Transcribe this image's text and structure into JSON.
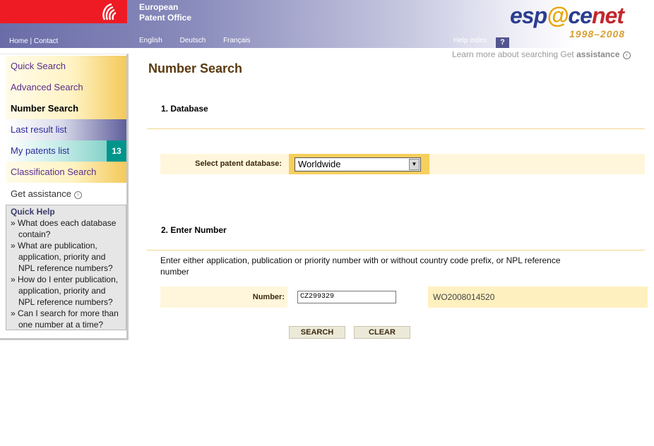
{
  "header": {
    "org_line1": "European",
    "org_line2": "Patent Office",
    "home": "Home",
    "contact": "Contact",
    "separator": "|",
    "languages": [
      "English",
      "Deutsch",
      "Français"
    ],
    "help_index": "Help index",
    "help_icon": "?",
    "logo_text_1": "esp",
    "logo_text_at": "@",
    "logo_text_2": "ce",
    "logo_text_3": "net",
    "logo_years": "1998–2008"
  },
  "learn_more": {
    "text": "Learn more about searching Get ",
    "bold": "assistance"
  },
  "sidebar": {
    "items": [
      {
        "label": "Quick Search"
      },
      {
        "label": "Advanced Search"
      },
      {
        "label": "Number Search"
      },
      {
        "label": "Last result list"
      },
      {
        "label": "My patents list",
        "badge": "13"
      },
      {
        "label": "Classification Search"
      },
      {
        "label": "Get assistance"
      }
    ],
    "quick_help": {
      "title": "Quick Help",
      "items": [
        "» What does each database contain?",
        "» What are publication, application, priority and NPL reference numbers?",
        "» How do I enter publication, application, priority and NPL reference numbers?",
        "» Can I search for more than one number at a time?"
      ]
    }
  },
  "main": {
    "title": "Number Search",
    "section1": "1. Database",
    "db_label": "Select patent database:",
    "db_value": "Worldwide",
    "section2": "2. Enter Number",
    "instructions": "Enter either application, publication or priority number with or without country code prefix, or NPL reference number",
    "number_label": "Number:",
    "number_value": "CZ299329",
    "number_example": "WO2008014520",
    "search_button": "SEARCH",
    "clear_button": "CLEAR"
  },
  "colors": {
    "epo_red": "#ee1b24",
    "gold": "#f7cf5c",
    "teal_badge": "#00958b",
    "title_brown": "#5a3a0f"
  }
}
